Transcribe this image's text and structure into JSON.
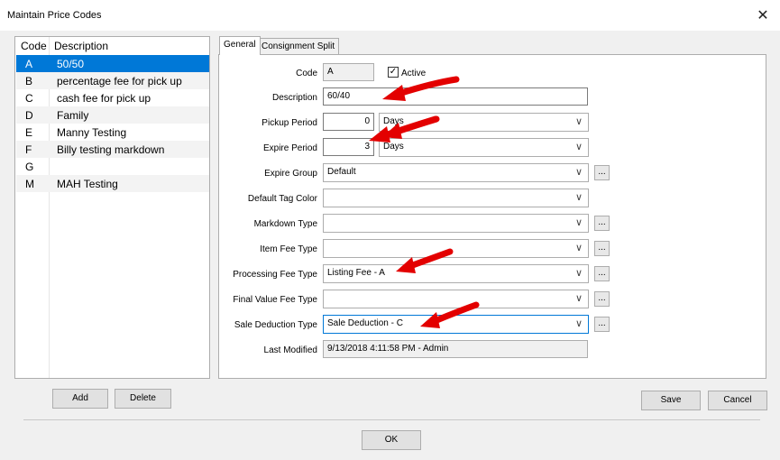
{
  "window": {
    "title": "Maintain Price Codes"
  },
  "list": {
    "headers": {
      "code": "Code",
      "description": "Description"
    },
    "rows": [
      {
        "code": "A",
        "description": "50/50"
      },
      {
        "code": "B",
        "description": "percentage fee for pick up"
      },
      {
        "code": "C",
        "description": "cash fee for pick up"
      },
      {
        "code": "D",
        "description": "Family"
      },
      {
        "code": "E",
        "description": "Manny Testing"
      },
      {
        "code": "F",
        "description": "Billy testing markdown"
      },
      {
        "code": "G",
        "description": ""
      },
      {
        "code": "M",
        "description": "MAH Testing"
      }
    ]
  },
  "tabs": [
    {
      "label": "General"
    },
    {
      "label": "Consignment Split"
    }
  ],
  "form": {
    "code_label": "Code",
    "code_value": "A",
    "active_label": "Active",
    "active_mark": "✓",
    "description_label": "Description",
    "description_value": "60/40",
    "pickup_label": "Pickup Period",
    "pickup_value": "0",
    "pickup_unit": "Days",
    "expire_period_label": "Expire Period",
    "expire_value": "3",
    "expire_unit": "Days",
    "expire_group_label": "Expire Group",
    "expire_group_value": "Default",
    "tag_color_label": "Default Tag Color",
    "tag_color_value": "",
    "markdown_label": "Markdown Type",
    "markdown_value": "",
    "item_fee_label": "Item Fee Type",
    "item_fee_value": "",
    "processing_fee_label": "Processing Fee Type",
    "processing_fee_value": "Listing Fee - A",
    "final_value_label": "Final Value Fee Type",
    "final_value_value": "",
    "sale_deduction_label": "Sale Deduction Type",
    "sale_deduction_value": "Sale Deduction - C",
    "last_modified_label": "Last Modified",
    "last_modified_value": "9/13/2018 4:11:58 PM - Admin",
    "ellipsis": "..."
  },
  "buttons": {
    "add": "Add",
    "delete": "Delete",
    "save": "Save",
    "cancel": "Cancel",
    "ok": "OK"
  },
  "icons": {
    "close": "✕",
    "chevron": "∨"
  },
  "colors": {
    "selection": "#0078d7",
    "arrow": "#e30000"
  }
}
